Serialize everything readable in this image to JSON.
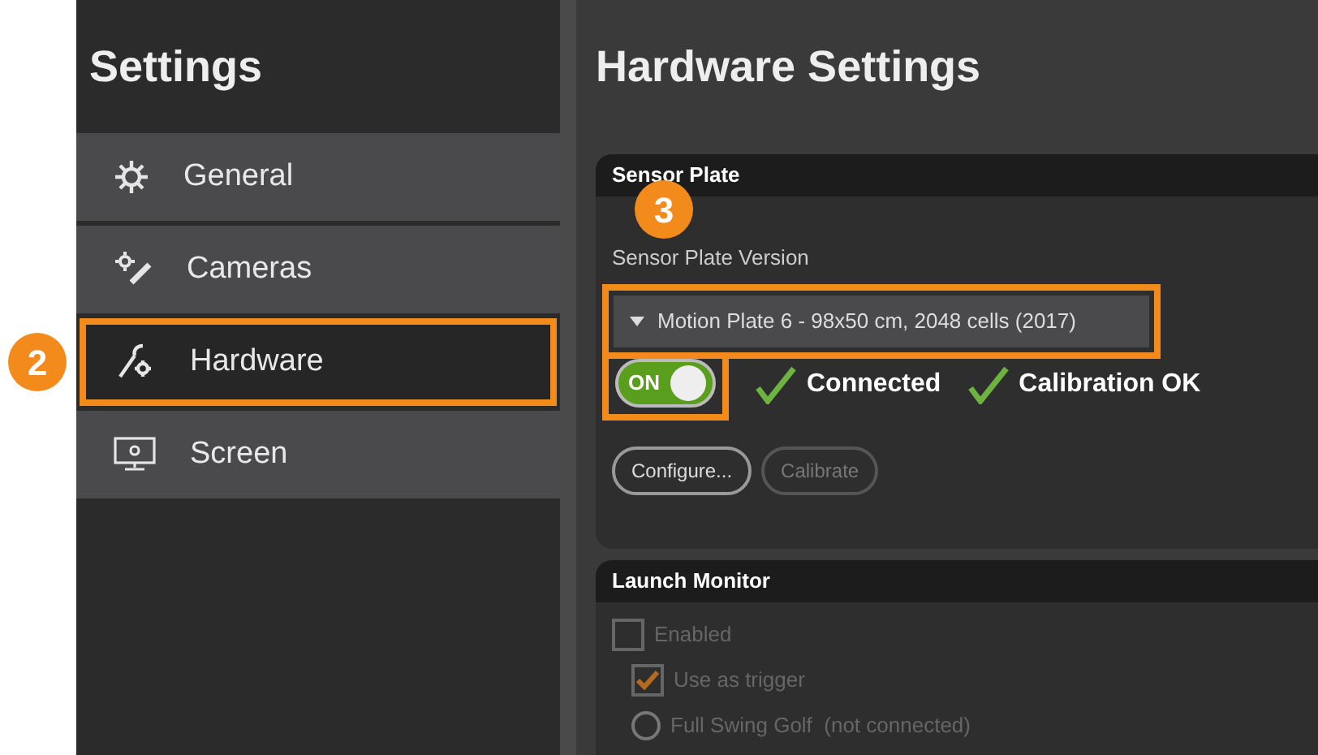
{
  "sidebar": {
    "title": "Settings",
    "items": [
      {
        "label": "General",
        "selected": false
      },
      {
        "label": "Cameras",
        "selected": false
      },
      {
        "label": "Hardware",
        "selected": true,
        "annotation": "2"
      },
      {
        "label": "Screen",
        "selected": false
      }
    ]
  },
  "main": {
    "title": "Hardware Settings",
    "sensor_plate": {
      "title": "Sensor Plate",
      "annotation": "3",
      "version_label": "Sensor Plate Version",
      "version_value": "Motion Plate 6 - 98x50 cm, 2048 cells (2017)",
      "toggle": {
        "label": "ON",
        "on": true
      },
      "statuses": [
        {
          "label": "Connected",
          "ok": true
        },
        {
          "label": "Calibration OK",
          "ok": true
        }
      ],
      "buttons": [
        {
          "label": "Configure...",
          "disabled": false
        },
        {
          "label": "Calibrate",
          "disabled": true
        }
      ]
    },
    "launch_monitor": {
      "title": "Launch Monitor",
      "options": [
        {
          "kind": "checkbox",
          "label": "Enabled",
          "checked": false,
          "disabled": true
        },
        {
          "kind": "checkbox",
          "label": "Use as trigger",
          "checked": true,
          "disabled": true
        },
        {
          "kind": "radio",
          "label": "Full Swing Golf  (not connected)",
          "checked": false,
          "disabled": true
        }
      ]
    }
  }
}
